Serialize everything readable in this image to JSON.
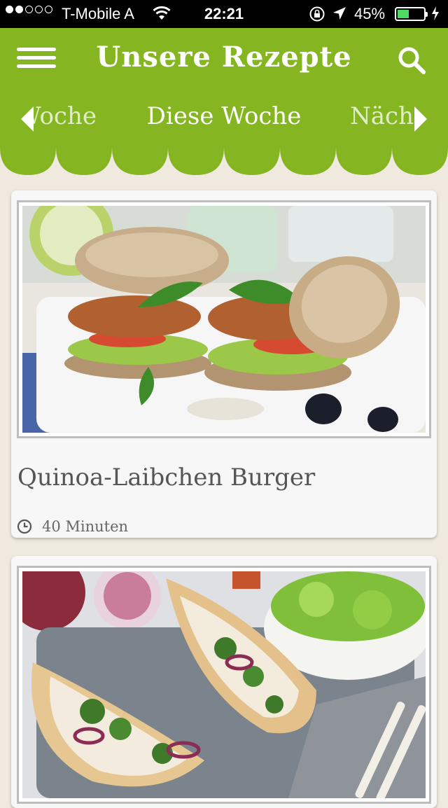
{
  "status_bar": {
    "carrier": "T-Mobile A",
    "time": "22:21",
    "battery_percent_label": "45%",
    "battery_level": 0.45,
    "signal_bars_filled": 2,
    "signal_bars_total": 5
  },
  "header": {
    "title": "Unsere Rezepte",
    "tabs": {
      "previous": "Woche",
      "current": "Diese Woche",
      "next": "Nächste Woche"
    },
    "color": "#85b622"
  },
  "recipes": [
    {
      "title": "Quinoa-Laibchen Burger",
      "duration": "40 Minuten"
    },
    {
      "title": ""
    }
  ],
  "icons": {
    "menu": "menu-icon",
    "search": "search-icon",
    "clock": "clock-icon",
    "wifi": "wifi-icon",
    "lock": "rotation-lock-icon",
    "location": "location-arrow-icon"
  }
}
